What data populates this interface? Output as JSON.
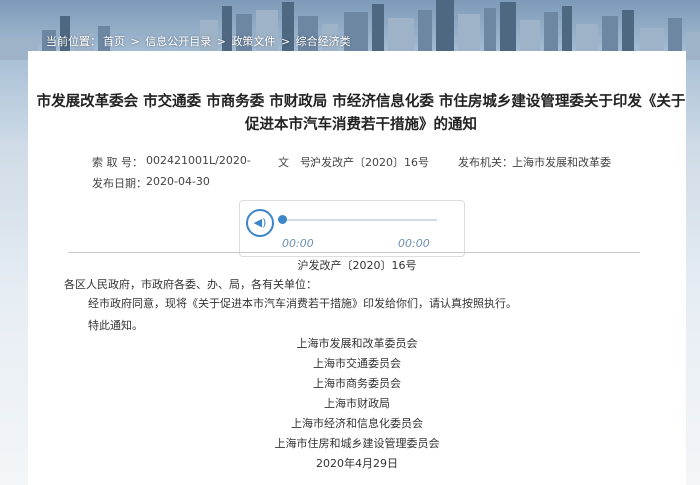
{
  "breadcrumb": {
    "items": [
      "当前位置：",
      "首页",
      "信息公开目录",
      "政策文件",
      "综合经济类"
    ],
    "separator": ">"
  },
  "document": {
    "title": "市发展改革委会 市交通委 市商务委 市财政局 市经济信息化委 市住房城乡建设管理委关于印发《关于促进本市汽车消费若干措施》的通知",
    "meta": {
      "index_label": "索 取 号：",
      "index_value": "002421001L/2020-",
      "doc_no_label": "文　号：",
      "doc_no_value": "沪发改产〔2020〕16号",
      "issuer_label": "发布机关：",
      "issuer_value": "上海市发展和改革委",
      "date_label": "发布日期：",
      "date_value": "2020-04-30"
    },
    "audio": {
      "current_time": "00:00",
      "duration": "00:00",
      "progress": 0
    },
    "doc_number": "沪发改产〔2020〕16号",
    "recipients": "各区人民政府，市政府各委、办、局，各有关单位：",
    "paragraph": "经市政府同意，现将《关于促进本市汽车消费若干措施》印发给你们，请认真按照执行。",
    "closing": "特此通知。",
    "signatories": [
      "上海市发展和改革委员会",
      "上海市交通委员会",
      "上海市商务委员会",
      "上海市财政局",
      "上海市经济和信息化委员会",
      "上海市住房和城乡建设管理委员会"
    ],
    "sign_date": "2020年4月29日"
  },
  "colors": {
    "accent": "#3a86c8",
    "text": "#333333"
  }
}
